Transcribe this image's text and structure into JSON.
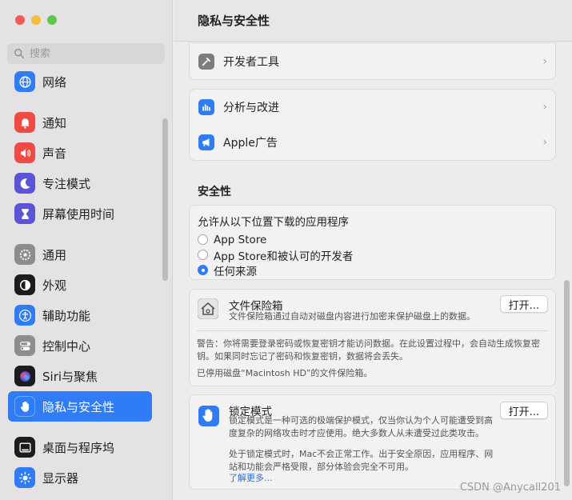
{
  "window": {
    "traffic_lights": {
      "close": "#ee5c55",
      "minimize": "#f5be3d",
      "zoom": "#5fc84a"
    }
  },
  "sidebar": {
    "search_placeholder": "搜索",
    "items": [
      {
        "label": "网络",
        "icon": "globe-icon",
        "color": "#2f7cf6"
      },
      {
        "label": "通知",
        "icon": "bell-icon",
        "color": "#ee4b44"
      },
      {
        "label": "声音",
        "icon": "speaker-icon",
        "color": "#ee4b44"
      },
      {
        "label": "专注模式",
        "icon": "moon-icon",
        "color": "#5b55d6"
      },
      {
        "label": "屏幕使用时间",
        "icon": "hourglass-icon",
        "color": "#5b55d6"
      },
      {
        "label": "通用",
        "icon": "gear-icon",
        "color": "#8e8d8e"
      },
      {
        "label": "外观",
        "icon": "appearance-icon",
        "color": "#1c1c1e"
      },
      {
        "label": "辅助功能",
        "icon": "accessibility-icon",
        "color": "#2f7cf6"
      },
      {
        "label": "控制中心",
        "icon": "toggles-icon",
        "color": "#8e8d8e"
      },
      {
        "label": "Siri与聚焦",
        "icon": "siri-icon",
        "color": "#1c1c1e"
      },
      {
        "label": "隐私与安全性",
        "icon": "hand-icon",
        "color": "#2f7cf6"
      },
      {
        "label": "桌面与程序坞",
        "icon": "dock-icon",
        "color": "#1c1c1e"
      },
      {
        "label": "显示器",
        "icon": "sun-icon",
        "color": "#2f7cf6"
      }
    ]
  },
  "header": {
    "title": "隐私与安全性"
  },
  "rows": {
    "developer": "开发者工具",
    "analytics": "分析与改进",
    "apple_ads": "Apple广告"
  },
  "security": {
    "title": "安全性",
    "allow_label": "允许从以下位置下载的应用程序",
    "options": [
      "App Store",
      "App Store和被认可的开发者",
      "任何来源"
    ],
    "selected_index": 2
  },
  "filevault": {
    "title": "文件保险箱",
    "desc": "文件保险箱通过自动对磁盘内容进行加密来保护磁盘上的数据。",
    "button": "打开...",
    "warning": "警告：你将需要登录密码或恢复密钥才能访问数据。在此设置过程中，会自动生成恢复密钥。如果同时忘记了密码和恢复密钥，数据将会丢失。",
    "status": "已停用磁盘“Macintosh HD”的文件保险箱。"
  },
  "lockdown": {
    "title": "锁定模式",
    "desc": "锁定模式是一种可选的极端保护模式，仅当你认为个人可能遭受到高度复杂的网络攻击时才应使用。绝大多数人从未遭受过此类攻击。",
    "button": "打开...",
    "detail": "处于锁定模式时，Mac不会正常工作。出于安全原因，应用程序、网站和功能会严格受限，部分体验会完全不可用。",
    "learn_more": "了解更多..."
  },
  "watermark": "CSDN @Anycall201"
}
